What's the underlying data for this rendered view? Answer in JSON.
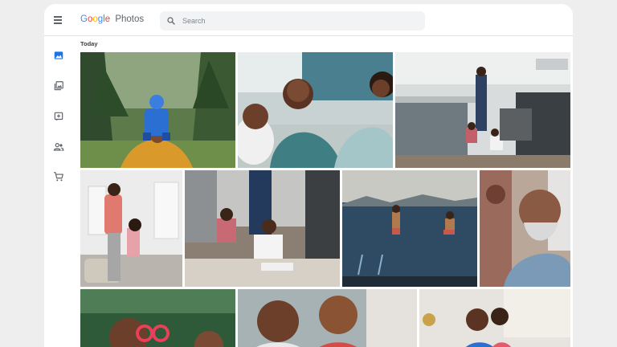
{
  "app": {
    "logo_letters": [
      "G",
      "o",
      "o",
      "g",
      "l",
      "e"
    ],
    "logo_colors": [
      "#4285F4",
      "#EA4335",
      "#FBBC05",
      "#4285F4",
      "#34A853",
      "#EA4335"
    ],
    "product_name": "Photos"
  },
  "search": {
    "placeholder": "Search"
  },
  "sidebar": {
    "items": [
      {
        "icon": "photos-icon",
        "active": true
      },
      {
        "icon": "albums-icon",
        "active": false
      },
      {
        "icon": "add-memory-icon",
        "active": false
      },
      {
        "icon": "sharing-icon",
        "active": false
      },
      {
        "icon": "print-store-icon",
        "active": false
      }
    ]
  },
  "section": {
    "title": "Today"
  },
  "colors": {
    "accent": "#1a73e8",
    "icon_gray": "#5f6368"
  }
}
